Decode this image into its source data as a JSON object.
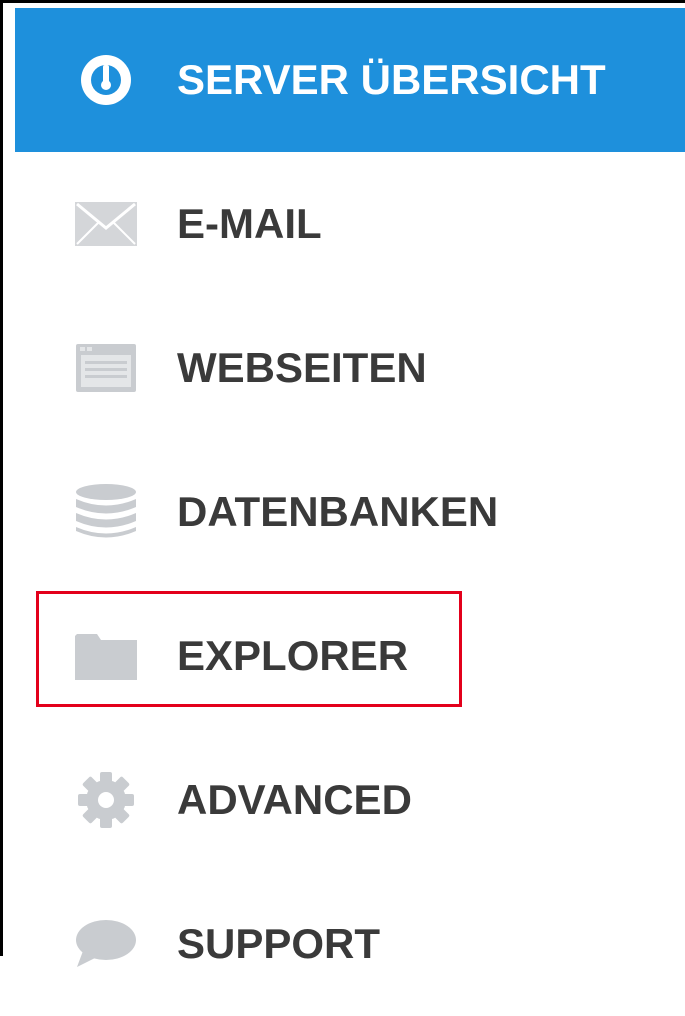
{
  "menu": {
    "items": [
      {
        "label": "SERVER ÜBERSICHT",
        "icon": "gauge-icon",
        "active": true
      },
      {
        "label": "E-MAIL",
        "icon": "envelope-icon",
        "active": false
      },
      {
        "label": "WEBSEITEN",
        "icon": "browser-window-icon",
        "active": false
      },
      {
        "label": "DATENBANKEN",
        "icon": "database-icon",
        "active": false
      },
      {
        "label": "EXPLORER",
        "icon": "folder-icon",
        "active": false
      },
      {
        "label": "ADVANCED",
        "icon": "gear-icon",
        "active": false
      },
      {
        "label": "SUPPORT",
        "icon": "speech-bubble-icon",
        "active": false
      }
    ]
  },
  "colors": {
    "active_background": "#1e90dc",
    "active_text": "#ffffff",
    "item_text": "#3a3a3a",
    "icon_gray": "#c9ccd0",
    "highlight_border": "#e3001b"
  },
  "highlight": {
    "target": "EXPLORER"
  }
}
